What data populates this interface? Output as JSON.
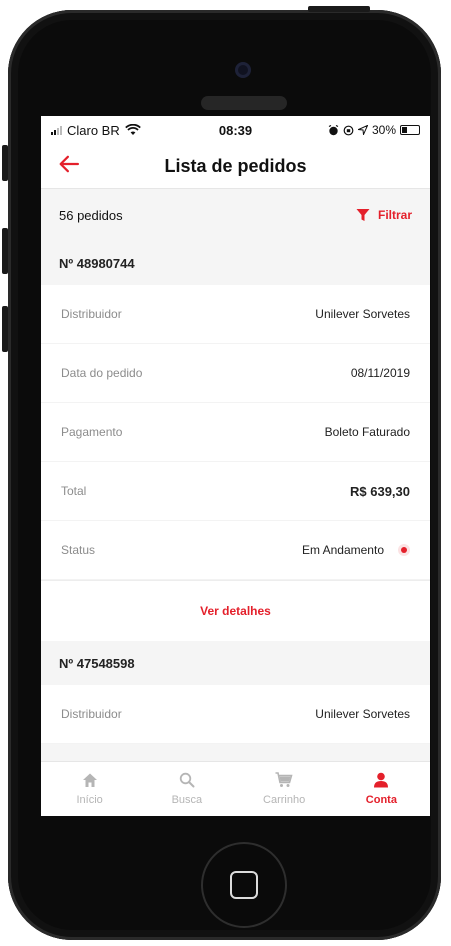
{
  "status_bar": {
    "carrier": "Claro BR",
    "time": "08:39",
    "battery": "30%"
  },
  "header": {
    "title": "Lista de pedidos"
  },
  "list": {
    "count": "56 pedidos",
    "filter_label": "Filtrar"
  },
  "orders": [
    {
      "number": "Nº 48980744",
      "rows": {
        "distributor_label": "Distribuidor",
        "distributor_value": "Unilever Sorvetes",
        "date_label": "Data do pedido",
        "date_value": "08/11/2019",
        "payment_label": "Pagamento",
        "payment_value": "Boleto Faturado",
        "total_label": "Total",
        "total_value": "R$ 639,30",
        "status_label": "Status",
        "status_value": "Em Andamento"
      },
      "details_label": "Ver detalhes"
    },
    {
      "number": "Nº 47548598",
      "rows": {
        "distributor_label": "Distribuidor",
        "distributor_value": "Unilever Sorvetes"
      }
    }
  ],
  "tabbar": [
    {
      "label": "Início",
      "icon": "home-icon"
    },
    {
      "label": "Busca",
      "icon": "search-icon"
    },
    {
      "label": "Carrinho",
      "icon": "cart-icon"
    },
    {
      "label": "Conta",
      "icon": "user-icon",
      "active": true
    }
  ],
  "colors": {
    "accent": "#e4202b",
    "background": "#f5f5f5"
  }
}
